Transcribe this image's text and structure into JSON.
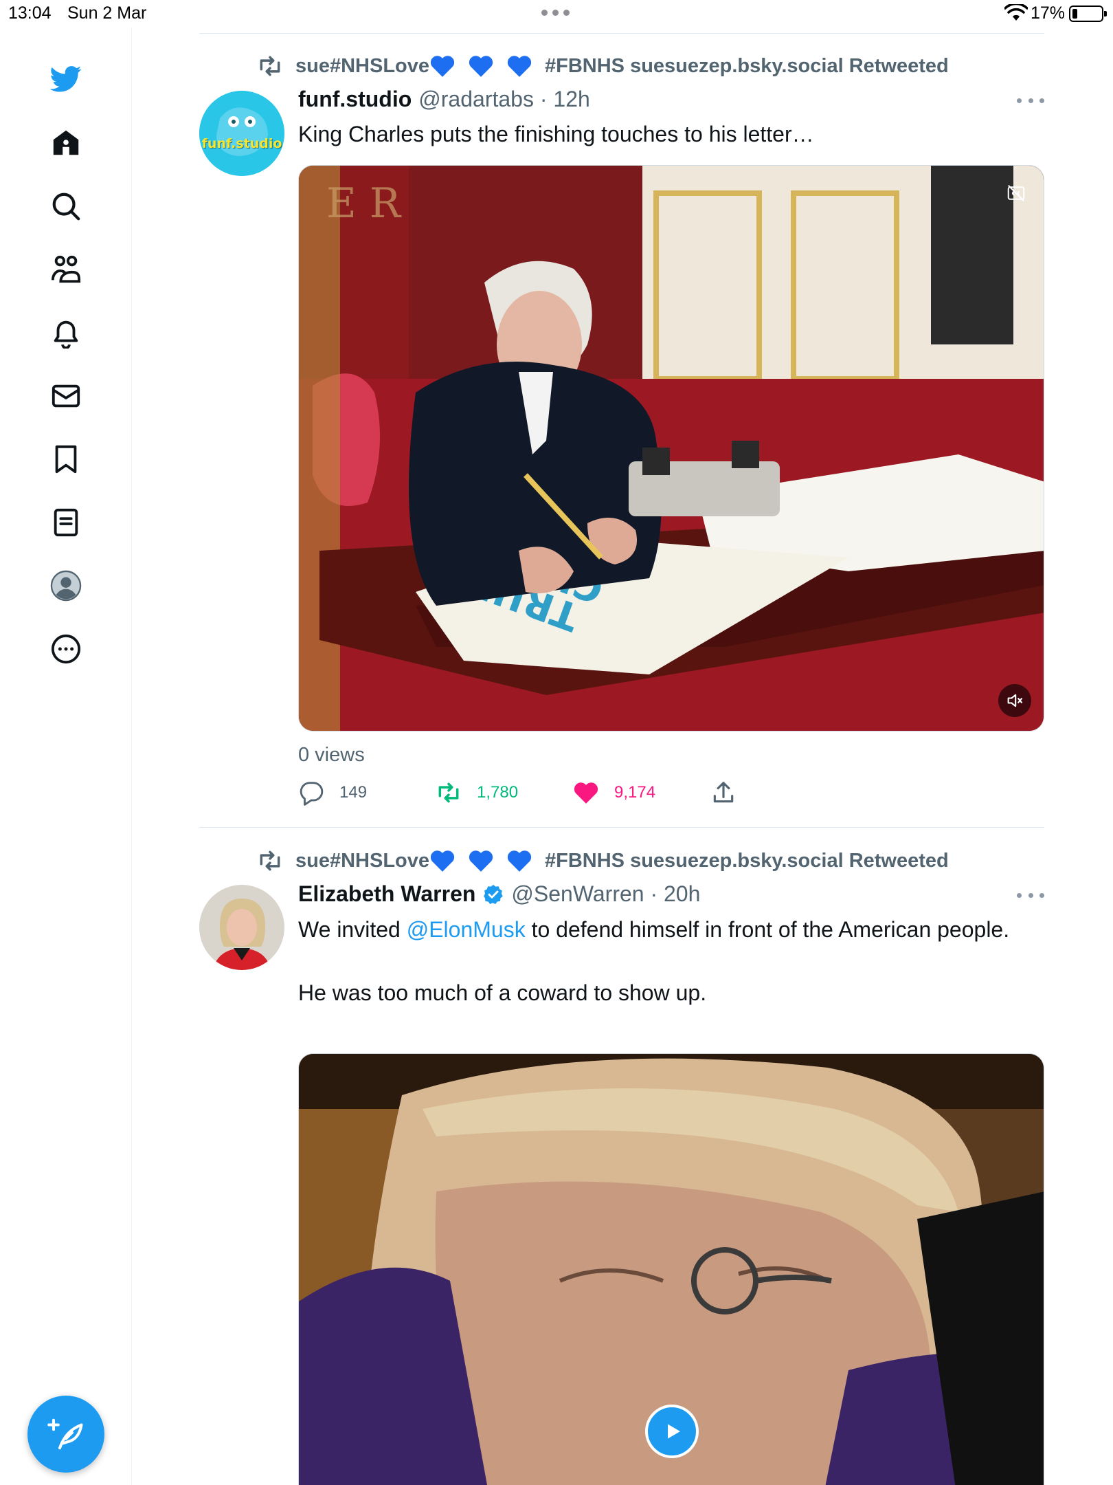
{
  "status_bar": {
    "time": "13:04",
    "date": "Sun 2 Mar",
    "battery": "17%",
    "battery_level": 0.17
  },
  "sidebar": {
    "items": [
      {
        "icon": "twitter-logo-icon"
      },
      {
        "icon": "home-icon"
      },
      {
        "icon": "search-icon"
      },
      {
        "icon": "communities-icon"
      },
      {
        "icon": "notifications-bell-icon"
      },
      {
        "icon": "messages-envelope-icon"
      },
      {
        "icon": "bookmark-icon"
      },
      {
        "icon": "lists-icon"
      },
      {
        "icon": "profile-avatar-icon"
      },
      {
        "icon": "more-circle-icon"
      }
    ],
    "compose_icon": "compose-feather-icon"
  },
  "tweets": [
    {
      "retweeted_by_prefix": "sue#NHSLove",
      "retweeted_by_suffix": "#FBNHS suesuezep.bsky.social Retweeted",
      "author_name": "funf.studio",
      "author_handle": "@radartabs",
      "time": "12h",
      "text": "King Charles puts the finishing touches to his letter…",
      "views": "0 views",
      "replies": "149",
      "retweets": "1,780",
      "likes": "9,174",
      "avatar_text": "funf.studio"
    },
    {
      "retweeted_by_prefix": "sue#NHSLove",
      "retweeted_by_suffix": "#FBNHS suesuezep.bsky.social Retweeted",
      "author_name": "Elizabeth Warren",
      "author_handle": "@SenWarren",
      "time": "20h",
      "text_before_mention": "We invited ",
      "mention": "@ElonMusk",
      "text_after_mention": " to defend himself in front of the American people.",
      "text_line2": "He was too much of a coward to show up."
    }
  ],
  "colors": {
    "accent": "#1d9bf0",
    "retweet_green": "#00ba7c",
    "like_pink": "#f91880",
    "secondary_text": "#536471"
  }
}
